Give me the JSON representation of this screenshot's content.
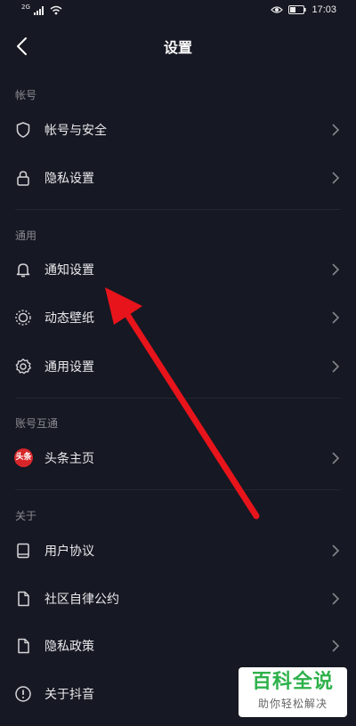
{
  "status_bar": {
    "signal_text": "2G",
    "time": "17:03"
  },
  "header": {
    "title": "设置"
  },
  "sections": [
    {
      "label": "帐号",
      "items": [
        {
          "label": "帐号与安全",
          "icon": "shield-icon"
        },
        {
          "label": "隐私设置",
          "icon": "lock-icon"
        }
      ]
    },
    {
      "label": "通用",
      "items": [
        {
          "label": "通知设置",
          "icon": "bell-icon"
        },
        {
          "label": "动态壁纸",
          "icon": "wallpaper-icon"
        },
        {
          "label": "通用设置",
          "icon": "gear-icon"
        }
      ]
    },
    {
      "label": "账号互通",
      "items": [
        {
          "label": "头条主页",
          "icon": "toutiao-icon",
          "badge": "头条"
        }
      ]
    },
    {
      "label": "关于",
      "items": [
        {
          "label": "用户协议",
          "icon": "book-icon"
        },
        {
          "label": "社区自律公约",
          "icon": "document-icon"
        },
        {
          "label": "隐私政策",
          "icon": "document-icon"
        },
        {
          "label": "关于抖音",
          "icon": "info-icon"
        }
      ]
    }
  ],
  "annotation": {
    "arrow_color": "#e8141b"
  },
  "watermark": {
    "title": "百科全说",
    "subtitle": "助你轻松解决"
  }
}
